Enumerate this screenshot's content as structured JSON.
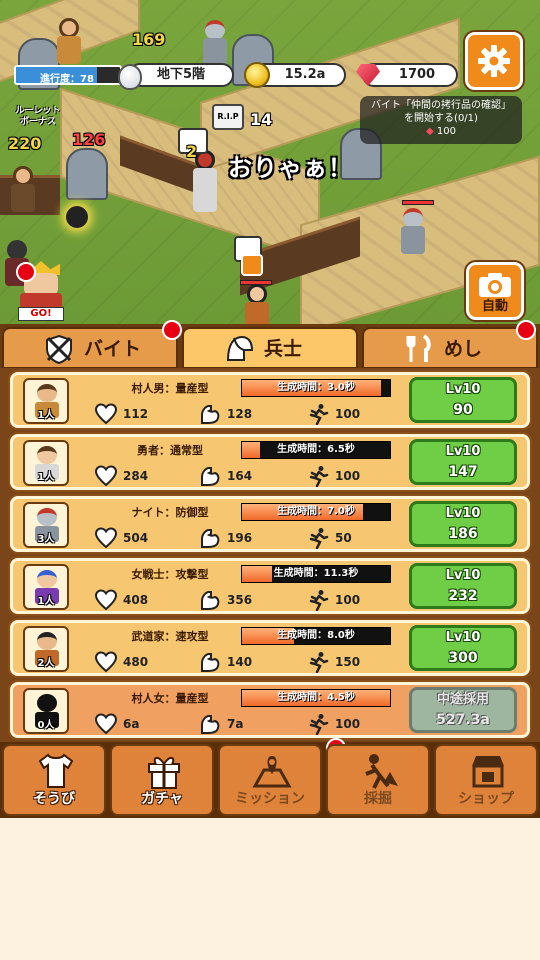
{
  "hud": {
    "progress_label": "進行度：78",
    "progress_value": 78,
    "floor": "地下5階",
    "gold": "15.2a",
    "gems": "1700",
    "roulette": "ルーレット ボーナス",
    "quest_line1": "バイト「仲間の拷行品の確認」",
    "quest_line2": "を開始する(0/1)",
    "quest_reward": "100",
    "auto_label": "自動",
    "rip_text": "R.I.P",
    "rip_count": "14",
    "shout": "おりゃぁ！",
    "dmg1": "169",
    "dmg2": "126",
    "dmg3": "220",
    "dmg4": "2",
    "go_label": "GO!"
  },
  "tabs": [
    {
      "label": "バイト",
      "icon": "shield-swords-icon"
    },
    {
      "label": "兵士",
      "icon": "helmet-icon"
    },
    {
      "label": "めし",
      "icon": "fork-knife-icon"
    }
  ],
  "units": [
    {
      "name": "村人男：量産型",
      "gen": "生成時間：3.0秒",
      "gen_ratio": 0.94,
      "count": "1人",
      "hp": "112",
      "atk": "128",
      "spd": "100",
      "level": "Lv10",
      "cost": "90",
      "skin": "#e9b98a",
      "hair": "#5a3a1a",
      "cloth": "#c98a3a"
    },
    {
      "name": "勇者：通常型",
      "gen": "生成時間：6.5秒",
      "gen_ratio": 0.12,
      "count": "1人",
      "hp": "284",
      "atk": "164",
      "spd": "100",
      "level": "Lv10",
      "cost": "147",
      "skin": "#f0c8a0",
      "hair": "#5a3a1a",
      "cloth": "#d8d8d8"
    },
    {
      "name": "ナイト：防御型",
      "gen": "生成時間：7.0秒",
      "gen_ratio": 0.82,
      "count": "3人",
      "hp": "504",
      "atk": "196",
      "spd": "50",
      "level": "Lv10",
      "cost": "186",
      "skin": "#b8c0c8",
      "hair": "#c0392b",
      "cloth": "#8a949e"
    },
    {
      "name": "女戦士：攻撃型",
      "gen": "生成時間：11.3秒",
      "gen_ratio": 0.2,
      "count": "1人",
      "hp": "408",
      "atk": "356",
      "spd": "100",
      "level": "Lv10",
      "cost": "232",
      "skin": "#f0c8a0",
      "hair": "#3a5fd0",
      "cloth": "#7a3ab0"
    },
    {
      "name": "武道家：速攻型",
      "gen": "生成時間：8.0秒",
      "gen_ratio": 0.35,
      "count": "2人",
      "hp": "480",
      "atk": "140",
      "spd": "150",
      "level": "Lv10",
      "cost": "300",
      "skin": "#e9b98a",
      "hair": "#222222",
      "cloth": "#c06a2a"
    },
    {
      "name": "村人女：量産型",
      "gen": "生成時間：4.5秒",
      "gen_ratio": 1.0,
      "count": "0人",
      "hp": "6a",
      "atk": "7a",
      "spd": "100",
      "level": "中途採用",
      "cost": "527.3a",
      "skin": "#111111",
      "hair": "#111111",
      "cloth": "#111111",
      "locked": true
    }
  ],
  "nav": [
    {
      "label": "そうび",
      "icon": "shirt-icon"
    },
    {
      "label": "ガチャ",
      "icon": "gift-icon"
    },
    {
      "label": "ミッション",
      "icon": "map-icon"
    },
    {
      "label": "採掘",
      "icon": "digger-icon"
    },
    {
      "label": "ショップ",
      "icon": "shop-icon"
    }
  ]
}
